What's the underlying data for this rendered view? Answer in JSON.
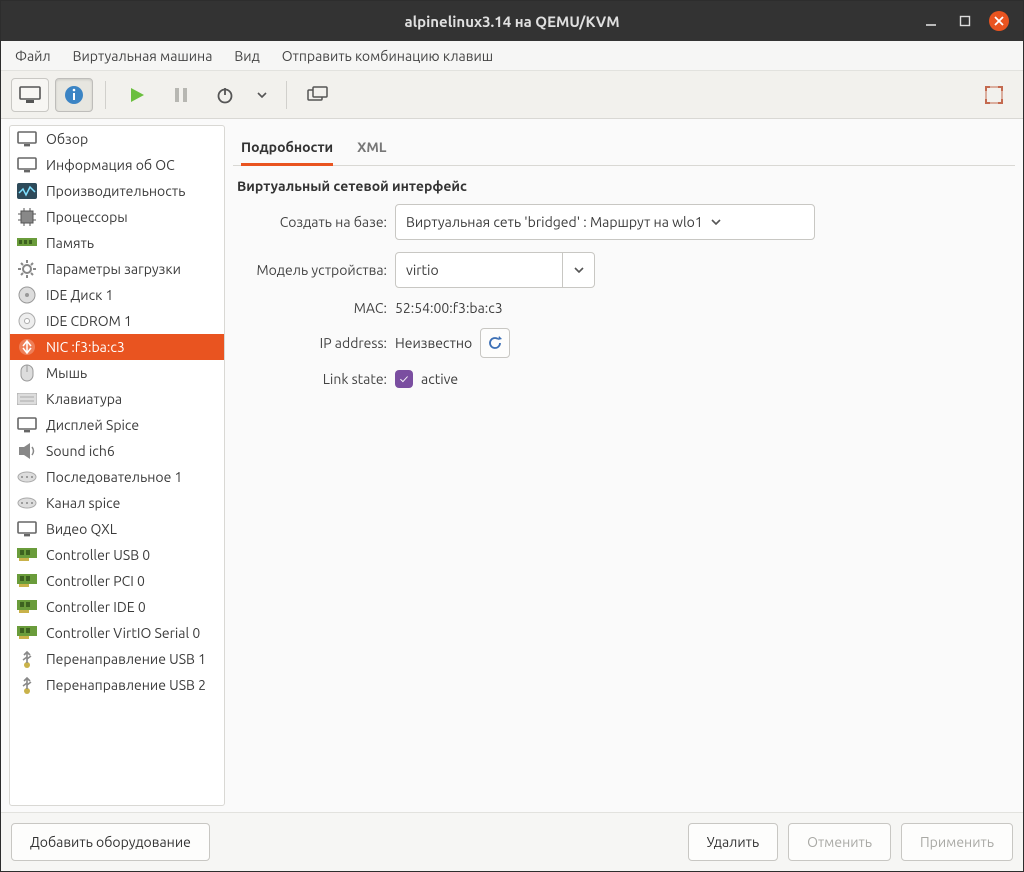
{
  "window": {
    "title": "alpinelinux3.14 на QEMU/KVM"
  },
  "menubar": [
    "Файл",
    "Виртуальная машина",
    "Вид",
    "Отправить комбинацию клавиш"
  ],
  "sidebar": {
    "items": [
      {
        "label": "Обзор",
        "icon": "monitor"
      },
      {
        "label": "Информация об ОС",
        "icon": "monitor"
      },
      {
        "label": "Производительность",
        "icon": "perf"
      },
      {
        "label": "Процессоры",
        "icon": "cpu"
      },
      {
        "label": "Память",
        "icon": "mem"
      },
      {
        "label": "Параметры загрузки",
        "icon": "gear"
      },
      {
        "label": "IDE Диск 1",
        "icon": "disk"
      },
      {
        "label": "IDE CDROM 1",
        "icon": "disc"
      },
      {
        "label": "NIC :f3:ba:c3",
        "icon": "nic",
        "selected": true
      },
      {
        "label": "Мышь",
        "icon": "mouse"
      },
      {
        "label": "Клавиатура",
        "icon": "keyboard"
      },
      {
        "label": "Дисплей Spice",
        "icon": "monitor"
      },
      {
        "label": "Sound ich6",
        "icon": "sound"
      },
      {
        "label": "Последовательное 1",
        "icon": "serial"
      },
      {
        "label": "Канал spice",
        "icon": "serial"
      },
      {
        "label": "Видео QXL",
        "icon": "monitor"
      },
      {
        "label": "Controller USB 0",
        "icon": "pci"
      },
      {
        "label": "Controller PCI 0",
        "icon": "pci"
      },
      {
        "label": "Controller IDE 0",
        "icon": "pci"
      },
      {
        "label": "Controller VirtIO Serial 0",
        "icon": "pci"
      },
      {
        "label": "Перенаправление USB 1",
        "icon": "usb"
      },
      {
        "label": "Перенаправление USB 2",
        "icon": "usb"
      }
    ]
  },
  "tabs": {
    "details": "Подробности",
    "xml": "XML"
  },
  "panel": {
    "heading": "Виртуальный сетевой интерфейс",
    "net_source_label": "Создать на базе:",
    "net_source_value": "Виртуальная сеть 'bridged' : Маршрут на wlo1",
    "model_label": "Модель устройства:",
    "model_value": "virtio",
    "mac_label": "MAC:",
    "mac_value": "52:54:00:f3:ba:c3",
    "ip_label": "IP address:",
    "ip_value": "Неизвестно",
    "link_label": "Link state:",
    "link_value": "active"
  },
  "footer": {
    "add_hw": "Добавить оборудование",
    "remove": "Удалить",
    "cancel": "Отменить",
    "apply": "Применить"
  }
}
